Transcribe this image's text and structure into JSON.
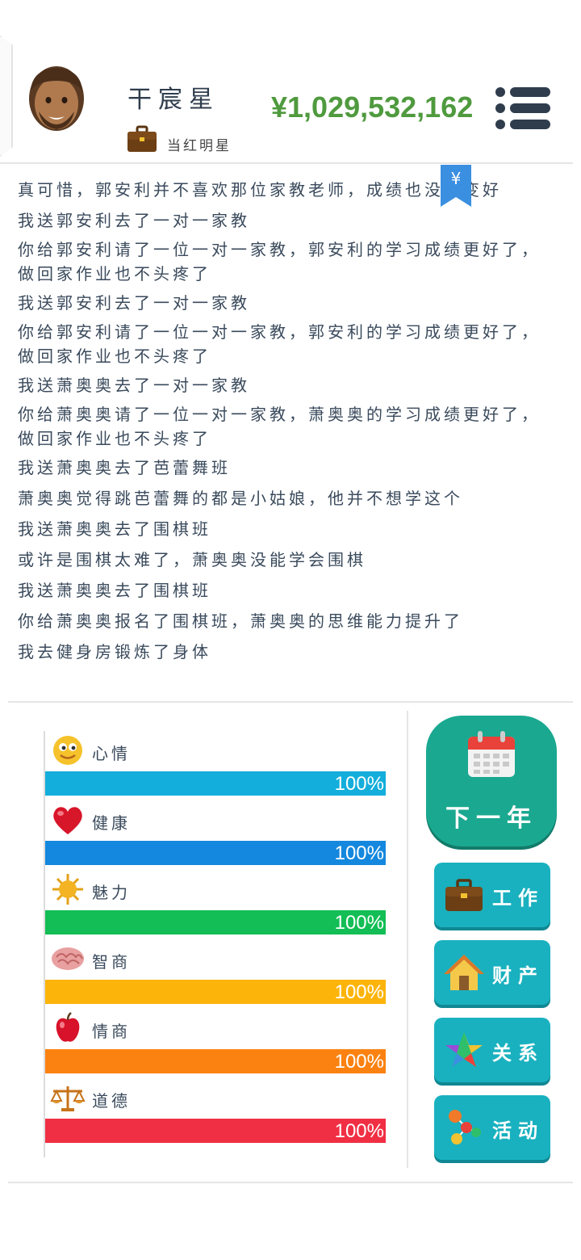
{
  "player": {
    "name": "干宸星",
    "job": "当红明星",
    "money": "¥1,029,532,162"
  },
  "log": [
    "真可惜，郭安利并不喜欢那位家教老师，成绩也没有变好",
    "我送郭安利去了一对一家教",
    "你给郭安利请了一位一对一家教，郭安利的学习成绩更好了，做回家作业也不头疼了",
    "我送郭安利去了一对一家教",
    "你给郭安利请了一位一对一家教，郭安利的学习成绩更好了，做回家作业也不头疼了",
    "我送萧奥奥去了一对一家教",
    "你给萧奥奥请了一位一对一家教，萧奥奥的学习成绩更好了，做回家作业也不头疼了",
    "我送萧奥奥去了芭蕾舞班",
    "萧奥奥觉得跳芭蕾舞的都是小姑娘，他并不想学这个",
    "我送萧奥奥去了围棋班",
    "或许是围棋太难了，萧奥奥没能学会围棋",
    "我送萧奥奥去了围棋班",
    "你给萧奥奥报名了围棋班，萧奥奥的思维能力提升了",
    "我去健身房锻炼了身体"
  ],
  "bookmark_symbol": "¥",
  "stats": [
    {
      "label": "心情",
      "value": "100%",
      "level": 1.0,
      "color": "#13aedb",
      "icon": "smiley-icon"
    },
    {
      "label": "健康",
      "value": "100%",
      "level": 1.0,
      "color": "#1488de",
      "icon": "heart-icon"
    },
    {
      "label": "魅力",
      "value": "100%",
      "level": 1.0,
      "color": "#12be55",
      "icon": "sun-icon"
    },
    {
      "label": "智商",
      "value": "100%",
      "level": 1.0,
      "color": "#fdb40a",
      "icon": "brain-icon"
    },
    {
      "label": "情商",
      "value": "100%",
      "level": 1.0,
      "color": "#fb8210",
      "icon": "apple-icon"
    },
    {
      "label": "道德",
      "value": "100%",
      "level": 1.0,
      "color": "#f12f44",
      "icon": "scales-icon"
    }
  ],
  "actions": {
    "next_year": "下一年",
    "work": "工作",
    "property": "财产",
    "relations": "关系",
    "activity": "活动"
  },
  "colors": {
    "money": "#4f9a3e",
    "next_year_btn": "#1aa890",
    "action_btn": "#19b1bf"
  }
}
